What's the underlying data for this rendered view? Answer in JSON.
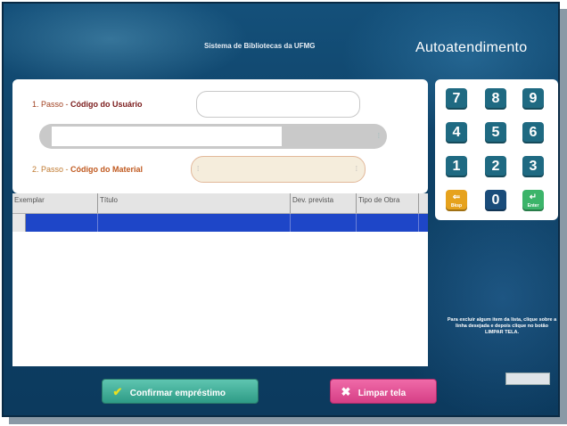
{
  "header": {
    "system_name": "Sistema de Bibliotecas da UFMG",
    "title": "Autoatendimento"
  },
  "form": {
    "step1_prefix": "1. Passo - ",
    "step1_label": "Código do Usuário",
    "user_code_value": "",
    "step2_prefix": "2. Passo - ",
    "step2_label": "Código do Material",
    "material_code_value": ""
  },
  "keypad": {
    "keys": [
      "7",
      "8",
      "9",
      "4",
      "5",
      "6",
      "1",
      "2",
      "3"
    ],
    "zero": "0",
    "backspace_label": "Bksp",
    "enter_label": "Enter"
  },
  "table": {
    "columns": [
      "Exemplar",
      "Título",
      "Dev. prevista",
      "Tipo de Obra"
    ]
  },
  "help_text": "Para excluir algum item da lista, clique sobre a linha desejada e depois clique no botão LIMPAR TELA.",
  "buttons": {
    "confirm": "Confirmar empréstimo",
    "clear": "Limpar tela"
  },
  "icons": {
    "confirm": "check-icon",
    "clear": "x-icon",
    "backspace": "backspace-arrow-icon",
    "enter": "enter-arrow-icon"
  },
  "colors": {
    "background": "#0d3f63",
    "selected_row": "#1e46c8",
    "confirm_button": "#2e9b86",
    "clear_button": "#d63f86",
    "backspace_key": "#e6a21d",
    "enter_key": "#3cb46a"
  }
}
